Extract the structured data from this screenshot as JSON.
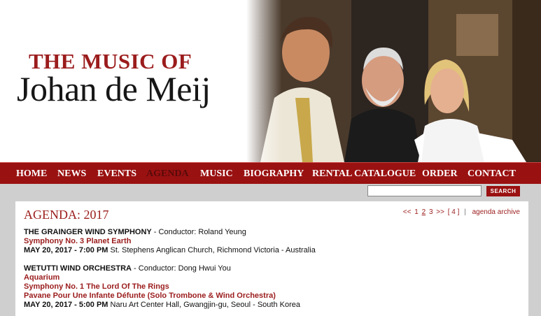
{
  "brand": {
    "top": "THE MUSIC OF",
    "name": "Johan de Meij"
  },
  "header_photo": "Photo of three smiling people: a man in a white suit, an older white-bearded man in black, and a blonde woman in a white feathered top",
  "nav": [
    {
      "label": "HOME"
    },
    {
      "label": "NEWS"
    },
    {
      "label": "EVENTS"
    },
    {
      "label": "AGENDA",
      "active": true
    },
    {
      "label": "MUSIC"
    },
    {
      "label": "BIOGRAPHY"
    },
    {
      "label": "RENTAL CATALOGUE"
    },
    {
      "label": "ORDER"
    },
    {
      "label": "CONTACT"
    }
  ],
  "search": {
    "value": "",
    "button_label": "SEARCH"
  },
  "agenda": {
    "title": "AGENDA: 2017",
    "pager": {
      "prev": "<<",
      "pages": [
        "1",
        "2",
        "3"
      ],
      "current": "2",
      "next": ">>",
      "last": "[ 4 ]",
      "separator": "|",
      "archive": "agenda archive"
    },
    "events": [
      {
        "ensemble": "THE GRAINGER WIND SYMPHONY",
        "conductor": " - Conductor: Roland Yeung",
        "works": [
          "Symphony No. 3 Planet Earth"
        ],
        "when": "MAY 20, 2017 - 7:00 PM",
        "venue": " St. Stephens Anglican Church, Richmond Victoria - Australia"
      },
      {
        "ensemble": "WETUTTI WIND ORCHESTRA",
        "conductor": " - Conductor: Dong Hwui You",
        "works": [
          "Aquarium",
          "Symphony No. 1 The Lord Of The Rings",
          "Pavane Pour Une Infante Défunte (Solo Trombone & Wind Orchestra)"
        ],
        "when": "MAY 20, 2017 - 5:00 PM",
        "venue": " Naru Art Center Hall, Gwangjin-gu, Seoul - South Korea"
      }
    ]
  }
}
